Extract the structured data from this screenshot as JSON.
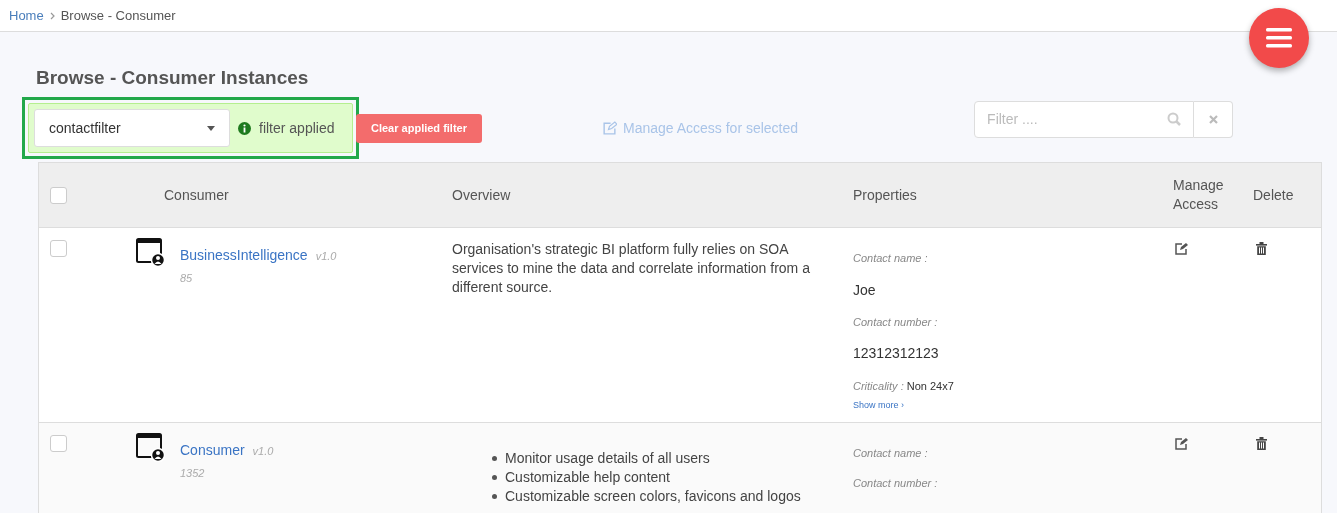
{
  "breadcrumb": [
    {
      "label": "Home",
      "link": true
    },
    {
      "label": "Browse - Consumer",
      "link": false
    }
  ],
  "page_title": "Browse - Consumer Instances",
  "filter_select": {
    "value": "contactfilter"
  },
  "filter_status": "filter applied",
  "clear_button": "Clear applied filter",
  "manage_selected": {
    "label": "Manage Access for selected",
    "disabled": true
  },
  "search": {
    "placeholder": "Filter ...."
  },
  "table": {
    "columns": [
      "Consumer",
      "Overview",
      "Properties",
      "Manage Access",
      "Delete"
    ],
    "select_all_checked": false,
    "rows": [
      {
        "checked": false,
        "name": "BusinessIntelligence",
        "version": "v1.0",
        "count": "85",
        "overview": {
          "kind": "text",
          "text": "Organisation's strategic BI platform fully relies on SOA services to mine the data and correlate information from a different source."
        },
        "properties": [
          {
            "label": "Contact name :",
            "value": "Joe"
          },
          {
            "label": "Contact number :",
            "value": "12312312123"
          }
        ],
        "criticality": {
          "label": "Criticality :",
          "value": "Non 24x7"
        },
        "show_more": "Show more ›"
      },
      {
        "checked": false,
        "name": "Consumer",
        "version": "v1.0",
        "count": "1352",
        "overview": {
          "kind": "list",
          "items": [
            "Monitor usage details of all users",
            "Customizable help content",
            "Customizable screen colors, favicons and logos"
          ]
        },
        "properties": [
          {
            "label": "Contact name :"
          },
          {
            "label": "Contact number :"
          }
        ]
      }
    ]
  }
}
